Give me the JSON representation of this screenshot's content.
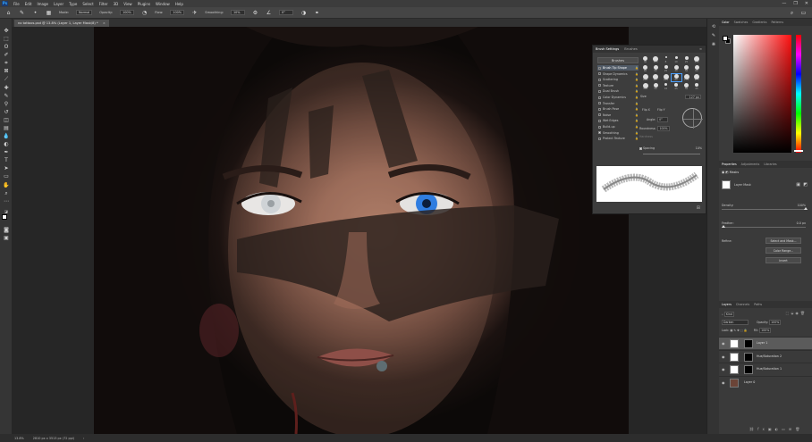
{
  "app": {
    "logo": "Ps",
    "menus": [
      "File",
      "Edit",
      "Image",
      "Layer",
      "Type",
      "Select",
      "Filter",
      "3D",
      "View",
      "Plugins",
      "Window",
      "Help"
    ],
    "window_controls": [
      "—",
      "❐",
      "✕"
    ]
  },
  "options_bar": {
    "mode_label": "Mode:",
    "mode_value": "Normal",
    "opacity_label": "Opacity:",
    "opacity_value": "100%",
    "flow_label": "Flow:",
    "flow_value": "100%",
    "smoothing_label": "Smoothing:",
    "smoothing_value": "10%",
    "angle_value": "0°"
  },
  "document": {
    "tab_title": "no tattoos.psd @ 13.8% (Layer 1, Layer Mask/8) *",
    "tab_close": "×",
    "status_zoom": "13.8%",
    "status_info": "2810 px x 3513 px (72 ppi)"
  },
  "brush_settings": {
    "tabs": [
      "Brush Settings",
      "Brushes"
    ],
    "brushes_button": "Brushes",
    "options": [
      {
        "label": "Brush Tip Shape",
        "checked": false,
        "active": true
      },
      {
        "label": "Shape Dynamics",
        "checked": false
      },
      {
        "label": "Scattering",
        "checked": false
      },
      {
        "label": "Texture",
        "checked": false
      },
      {
        "label": "Dual Brush",
        "checked": false
      },
      {
        "label": "Color Dynamics",
        "checked": false
      },
      {
        "label": "Transfer",
        "checked": false
      },
      {
        "label": "Brush Pose",
        "checked": false
      },
      {
        "label": "Noise",
        "checked": false
      },
      {
        "label": "Wet Edges",
        "checked": false
      },
      {
        "label": "Build-up",
        "checked": false
      },
      {
        "label": "Smoothing",
        "checked": true
      },
      {
        "label": "Protect Texture",
        "checked": false
      }
    ],
    "tip_numbers": [
      "30",
      "123",
      "8",
      "10",
      "25",
      "112",
      "60",
      "50",
      "25",
      "30",
      "50",
      "60",
      "100",
      "127",
      "284",
      "80",
      "174",
      "175",
      "306",
      "50",
      "16",
      "25",
      "50",
      "25"
    ],
    "size_label": "Size",
    "size_value": "127 px",
    "flip_x": "Flip X",
    "flip_y": "Flip Y",
    "angle_label": "Angle:",
    "angle_value": "0°",
    "roundness_label": "Roundness:",
    "roundness_value": "100%",
    "hardness_label": "Hardness",
    "spacing_label": "Spacing",
    "spacing_value": "10%"
  },
  "color_panel": {
    "tabs": [
      "Color",
      "Swatches",
      "Gradients",
      "Patterns"
    ],
    "foreground": "#ffffff",
    "background": "#000000"
  },
  "properties_panel": {
    "tabs": [
      "Properties",
      "Adjustments",
      "Libraries"
    ],
    "header": "Masks",
    "mask_label": "Layer Mask",
    "density_label": "Density:",
    "density_value": "100%",
    "density": 1.0,
    "feather_label": "Feather:",
    "feather_value": "0.0 px",
    "feather": 0.0,
    "refine_label": "Refine:",
    "buttons": [
      "Select and Mask...",
      "Color Range...",
      "Invert"
    ]
  },
  "layers_panel": {
    "tabs": [
      "Layers",
      "Channels",
      "Paths"
    ],
    "filter_label": "Kind",
    "blend_mode": "Darken",
    "opacity_label": "Opacity:",
    "opacity_value": "100%",
    "lock_label": "Lock:",
    "fill_label": "Fill:",
    "fill_value": "100%",
    "layers": [
      {
        "name": "Layer 1",
        "selected": true
      },
      {
        "name": "Hue/Saturation 2",
        "selected": false
      },
      {
        "name": "Hue/Saturation 1",
        "selected": false
      },
      {
        "name": "Layer 0",
        "selected": false
      }
    ]
  },
  "icons": {
    "toolbar": [
      "move-icon",
      "marquee-icon",
      "lasso-icon",
      "quick-select-icon",
      "crop-icon",
      "frame-icon",
      "eyedropper-icon",
      "healing-icon",
      "brush-icon",
      "clone-stamp-icon",
      "history-brush-icon",
      "eraser-icon",
      "gradient-icon",
      "blur-icon",
      "dodge-icon",
      "pen-icon",
      "type-icon",
      "path-select-icon",
      "rectangle-icon",
      "hand-icon",
      "zoom-icon",
      "more-tools-icon"
    ]
  }
}
